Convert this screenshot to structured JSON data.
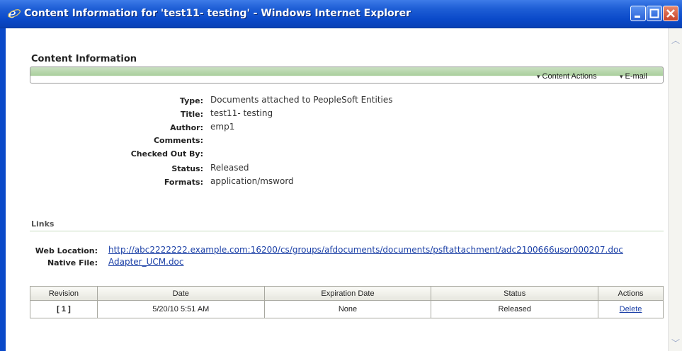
{
  "window": {
    "title": "Content Information for 'test11- testing' - Windows Internet Explorer",
    "colors": {
      "titlebar": "#0a49c9",
      "close": "#c9442a",
      "link": "#1a3fa6",
      "actionbar": "#a9cf9c"
    }
  },
  "page": {
    "heading": "Content Information",
    "actions": {
      "content_actions": "Content Actions",
      "email": "E-mail"
    }
  },
  "properties": [
    {
      "label": "Type:",
      "value": "Documents attached to PeopleSoft Entities"
    },
    {
      "label": "Title:",
      "value": "test11- testing"
    },
    {
      "label": "Author:",
      "value": "emp1"
    },
    {
      "label": "Comments:",
      "value": ""
    },
    {
      "label": "Checked Out By:",
      "value": ""
    },
    {
      "label": "Status:",
      "value": "Released"
    },
    {
      "label": "Formats:",
      "value": "application/msword"
    }
  ],
  "links": {
    "heading": "Links",
    "web_location_label": "Web Location:",
    "web_location_url": "http://abc2222222.example.com:16200/cs/groups/afdocuments/documents/psftattachment/adc2100666usor000207.doc",
    "native_file_label": "Native File:",
    "native_file_name": "Adapter_UCM.doc"
  },
  "revisions": {
    "headers": [
      "Revision",
      "Date",
      "Expiration Date",
      "Status",
      "Actions"
    ],
    "rows": [
      {
        "revision": "[ 1 ]",
        "date": "5/20/10 5:51 AM",
        "expiration": "None",
        "status": "Released",
        "action": "Delete"
      }
    ]
  }
}
